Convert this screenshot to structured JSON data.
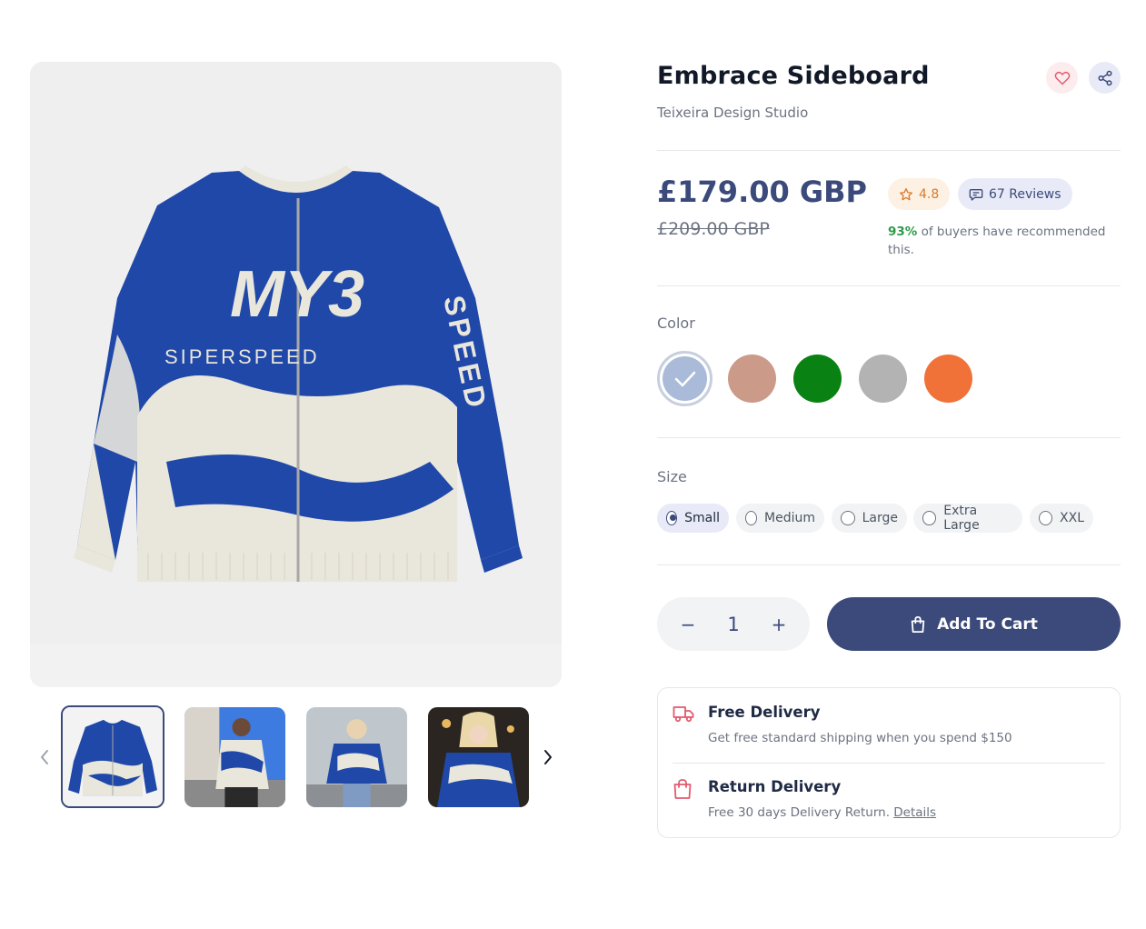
{
  "product": {
    "title": "Embrace Sideboard",
    "brand": "Teixeira Design Studio",
    "price": "£179.00 GBP",
    "old_price": "£209.00 GBP",
    "rating": "4.8",
    "reviews": "67 Reviews",
    "recommend_pct": "93%",
    "recommend_text": " of buyers have recommended this."
  },
  "gallery": {
    "main_image_icon": "cardigan-image",
    "thumbnails": [
      {
        "icon": "cardigan-thumbnail",
        "active": true
      },
      {
        "icon": "model-photo-thumbnail",
        "active": false
      },
      {
        "icon": "model-photo-thumbnail",
        "active": false
      },
      {
        "icon": "model-photo-thumbnail",
        "active": false
      }
    ],
    "sweater_text": {
      "logo": "MY3",
      "chest": "SIPERSPEED",
      "sleeve": "SPEED"
    }
  },
  "color": {
    "label": "Color",
    "options": [
      {
        "name": "light-blue",
        "hex": "#a9bbd8",
        "selected": true
      },
      {
        "name": "rose-tan",
        "hex": "#cb9a89",
        "selected": false
      },
      {
        "name": "green",
        "hex": "#0a8213",
        "selected": false
      },
      {
        "name": "gray",
        "hex": "#b3b3b3",
        "selected": false
      },
      {
        "name": "orange",
        "hex": "#f17238",
        "selected": false
      }
    ]
  },
  "size": {
    "label": "Size",
    "options": [
      "Small",
      "Medium",
      "Large",
      "Extra Large",
      "XXL"
    ],
    "selected": "Small"
  },
  "quantity": {
    "value": "1",
    "minus": "−",
    "plus": "+"
  },
  "cart": {
    "label": "Add To Cart"
  },
  "info": {
    "free_delivery_title": "Free Delivery",
    "free_delivery_desc": "Get free standard shipping when you spend $150",
    "return_title": "Return Delivery",
    "return_desc": "Free 30 days Delivery Return. ",
    "return_link": "Details"
  },
  "colors": {
    "accent": "#3b4a7a",
    "sweater_blue": "#1f48a8",
    "sweater_cream": "#e9e6dc",
    "wish_red": "#e35a6d",
    "star_orange": "#d97a2b",
    "success_green": "#2e9a4a"
  }
}
